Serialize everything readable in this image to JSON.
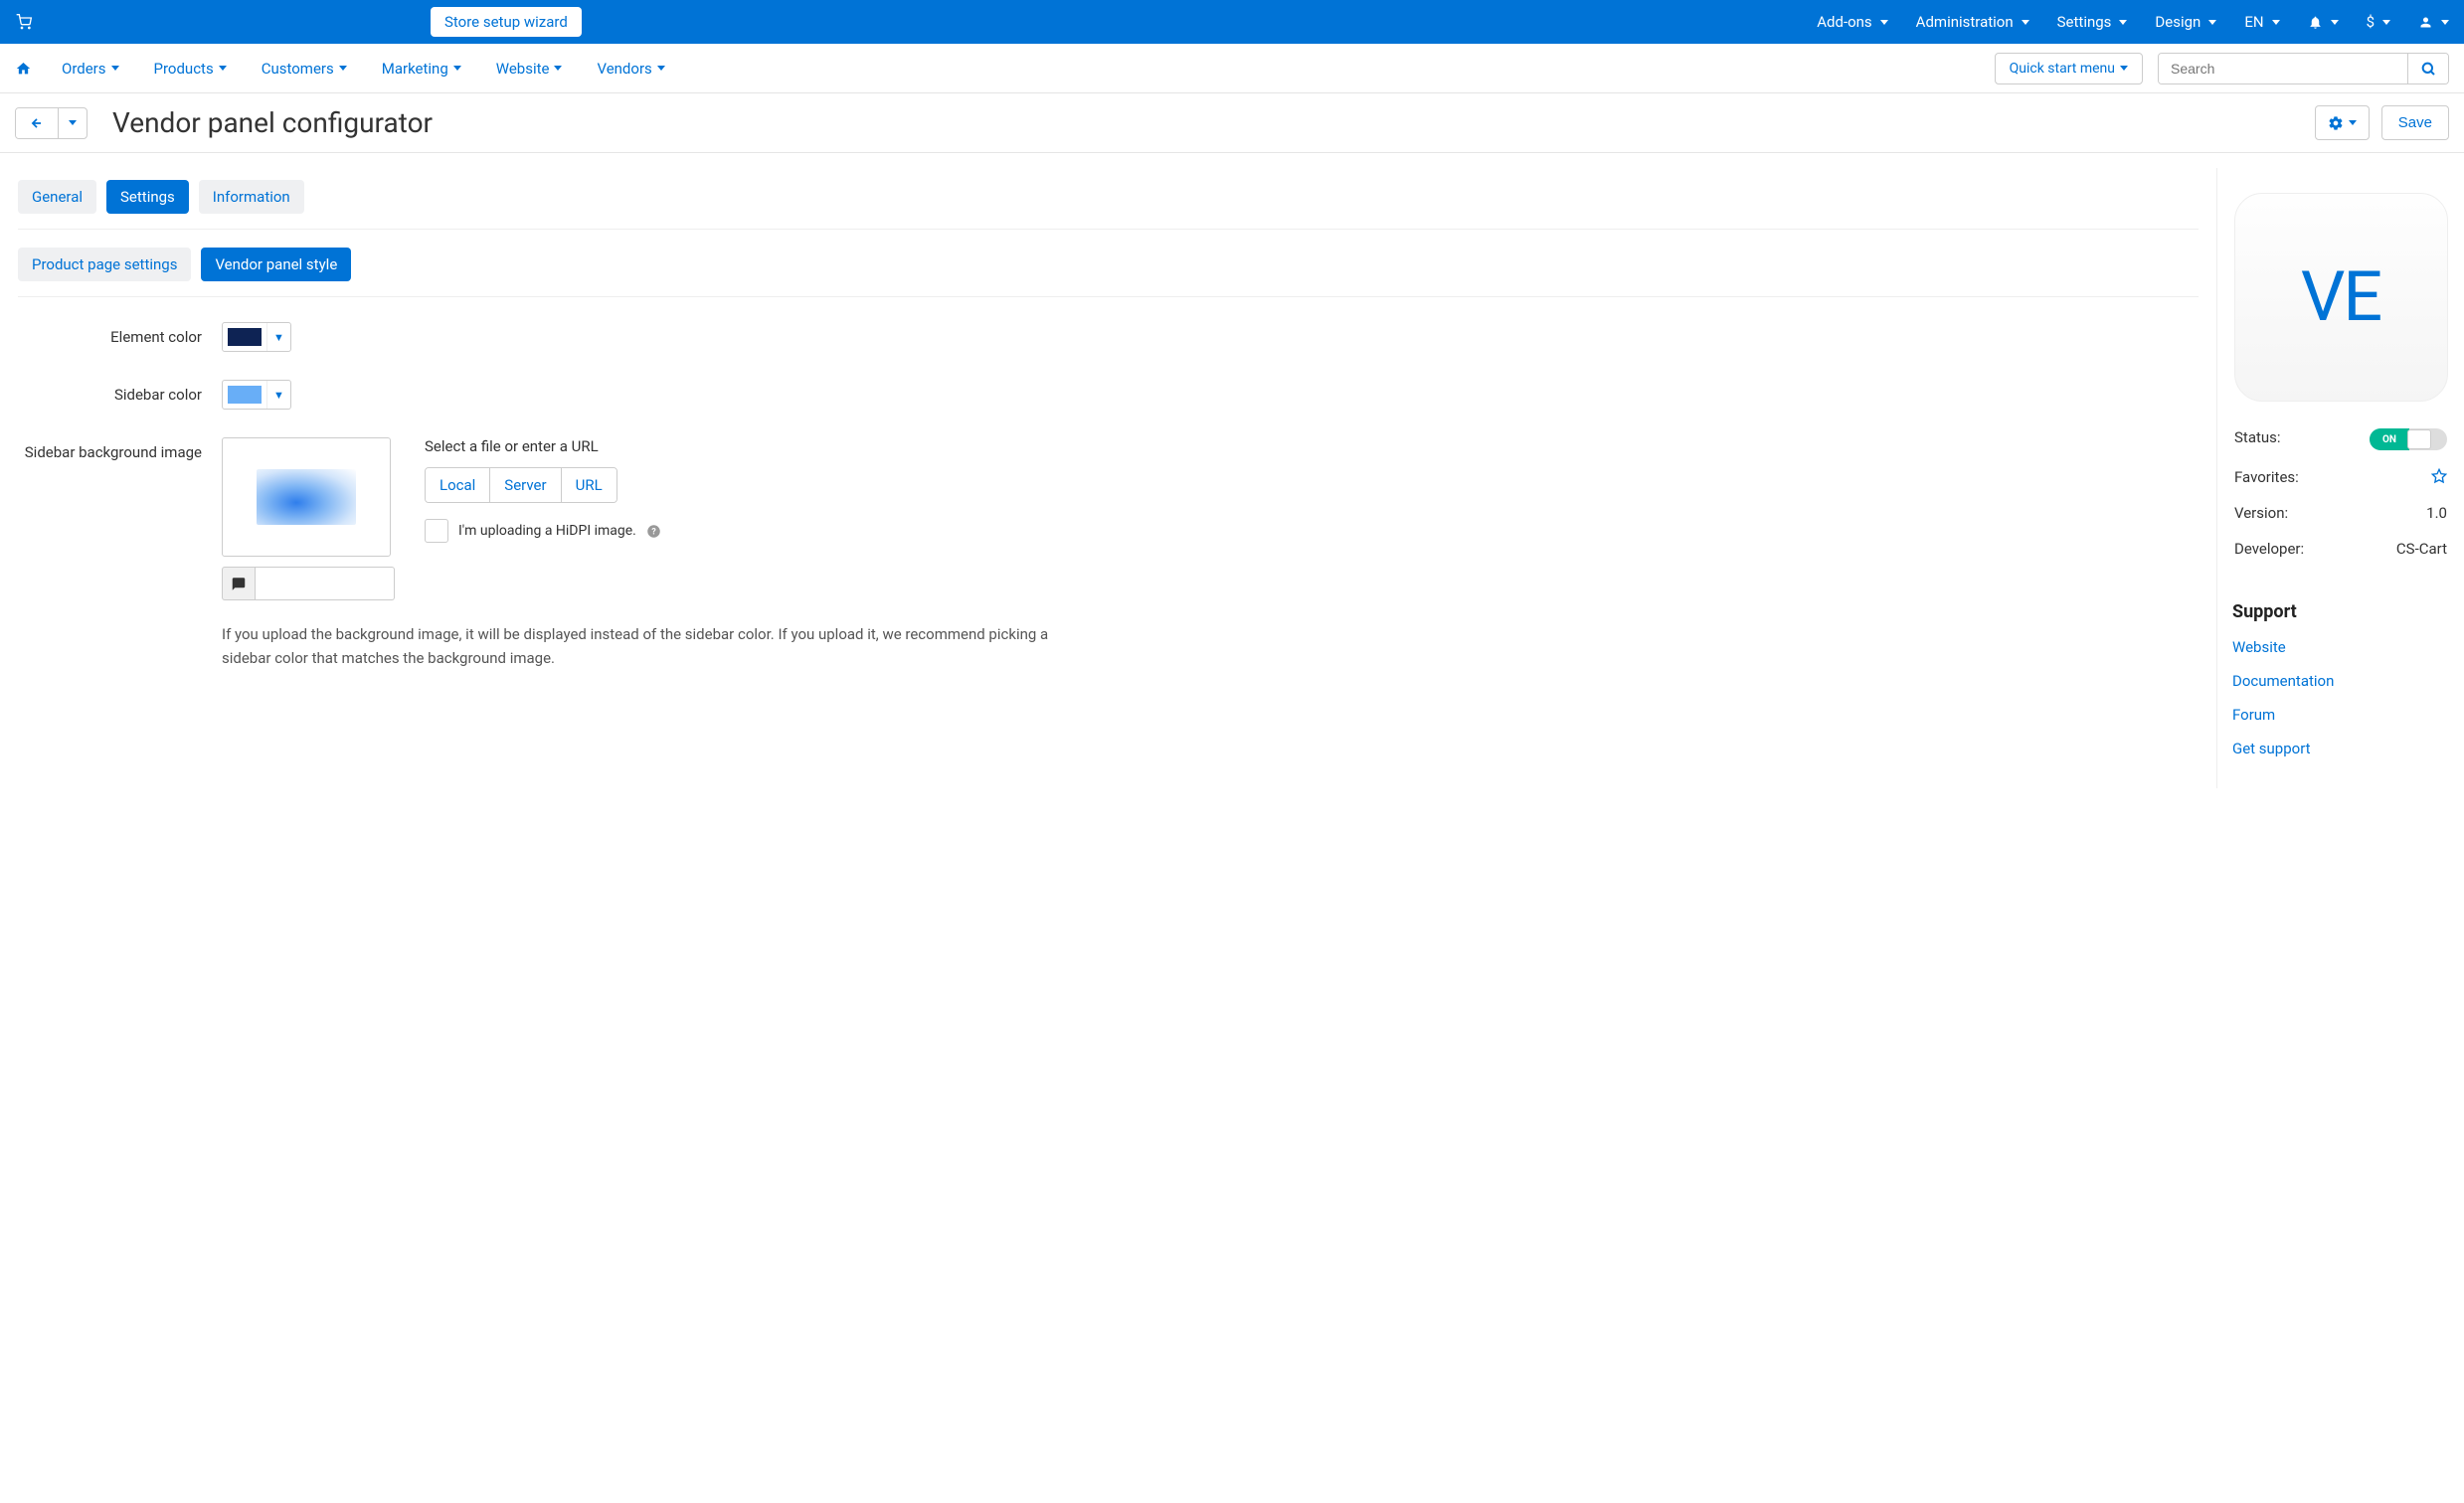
{
  "topbar": {
    "wizard_label": "Store setup wizard",
    "items": [
      "Add-ons",
      "Administration",
      "Settings",
      "Design"
    ],
    "lang": "EN",
    "currency": "$"
  },
  "nav": {
    "items": [
      "Orders",
      "Products",
      "Customers",
      "Marketing",
      "Website",
      "Vendors"
    ],
    "quick_start": "Quick start menu",
    "search_placeholder": "Search"
  },
  "header": {
    "title": "Vendor panel configurator",
    "save_label": "Save"
  },
  "tabs": {
    "main": [
      "General",
      "Settings",
      "Information"
    ],
    "main_active": 1,
    "sub": [
      "Product page settings",
      "Vendor panel style"
    ],
    "sub_active": 1
  },
  "form": {
    "element_color_label": "Element color",
    "element_color": "#0e2354",
    "sidebar_color_label": "Sidebar color",
    "sidebar_color": "#68aef7",
    "bg_image_label": "Sidebar background image",
    "upload_title": "Select a file or enter a URL",
    "upload_buttons": [
      "Local",
      "Server",
      "URL"
    ],
    "hidpi_label": "I'm uploading a HiDPI image.",
    "help_text": "If you upload the background image, it will be displayed instead of the sidebar color. If you upload it, we recommend picking a sidebar color that matches the background image."
  },
  "side": {
    "logo_text": "VE",
    "status_label": "Status:",
    "status_on": "ON",
    "favorites_label": "Favorites:",
    "version_label": "Version:",
    "version_value": "1.0",
    "developer_label": "Developer:",
    "developer_value": "CS-Cart",
    "support_title": "Support",
    "support_links": [
      "Website",
      "Documentation",
      "Forum",
      "Get support"
    ]
  }
}
